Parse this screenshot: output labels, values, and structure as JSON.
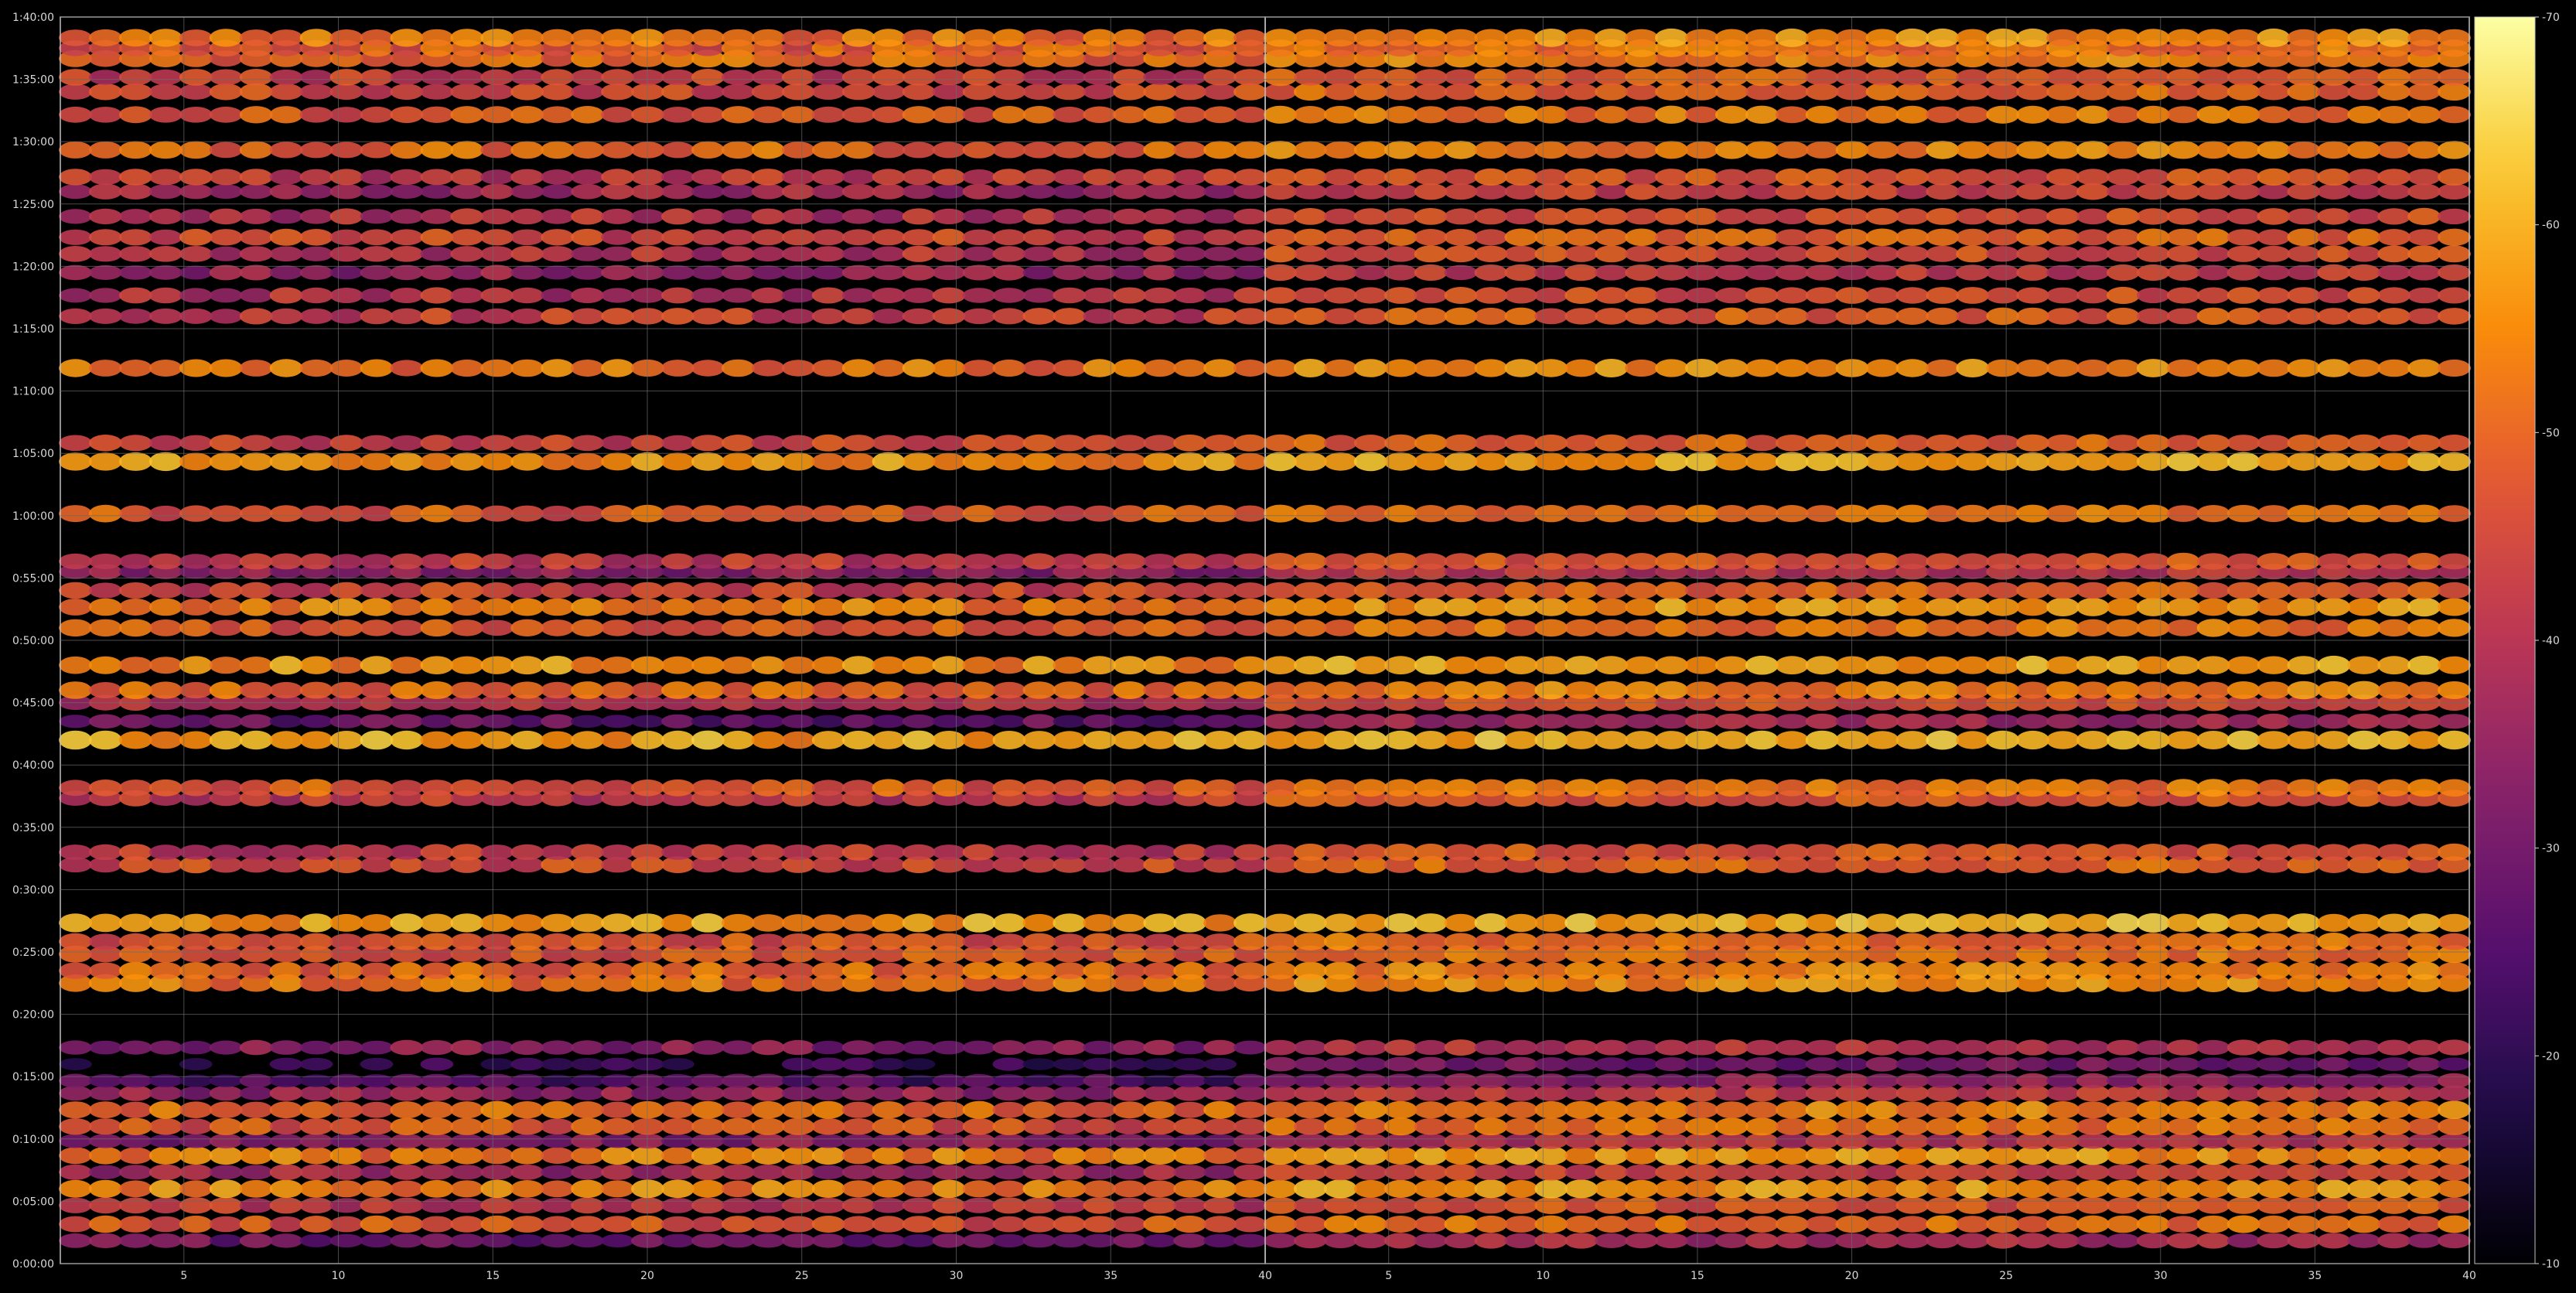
{
  "chart_data": {
    "type": "heatmap",
    "title": "",
    "xlabel": "",
    "ylabel": "",
    "grid": true,
    "background": "#000000",
    "colormap": "inferno",
    "colorbar": {
      "range": [
        -70,
        -10
      ],
      "ticks": [
        -10,
        -20,
        -30,
        -40,
        -50,
        -60,
        -70
      ],
      "tick_labels": [
        "-10",
        "-20",
        "-30",
        "-40",
        "-50",
        "-60",
        "-70"
      ]
    },
    "y_axis": {
      "unit": "h:mm:ss",
      "range_seconds": [
        0,
        6000
      ],
      "ticks": [
        "0:00:00",
        "0:05:00",
        "0:10:00",
        "0:15:00",
        "0:20:00",
        "0:25:00",
        "0:30:00",
        "0:35:00",
        "0:40:00",
        "0:45:00",
        "0:50:00",
        "0:55:00",
        "1:00:00",
        "1:05:00",
        "1:10:00",
        "1:15:00",
        "1:20:00",
        "1:25:00",
        "1:30:00",
        "1:35:00",
        "1:40:00"
      ]
    },
    "panels": [
      {
        "x_range": [
          1,
          40
        ],
        "x_ticks": [
          "5",
          "10",
          "15",
          "20",
          "25",
          "30",
          "35",
          "40"
        ],
        "level_scale": 1.0
      },
      {
        "x_range": [
          1,
          40
        ],
        "x_ticks": [
          "5",
          "10",
          "15",
          "20",
          "25",
          "30",
          "35",
          "40"
        ],
        "level_scale": 0.8
      }
    ],
    "bands": [
      {
        "t": 110,
        "level": -30
      },
      {
        "t": 190,
        "level": -47
      },
      {
        "t": 280,
        "level": -42
      },
      {
        "t": 360,
        "level": -54
      },
      {
        "t": 440,
        "level": -37
      },
      {
        "t": 520,
        "level": -53
      },
      {
        "t": 590,
        "level": -33
      },
      {
        "t": 660,
        "level": -47
      },
      {
        "t": 740,
        "level": -50
      },
      {
        "t": 820,
        "level": -35
      },
      {
        "t": 880,
        "level": -25
      },
      {
        "t": 960,
        "level": -20
      },
      {
        "t": 1040,
        "level": -33
      },
      {
        "t": 1350,
        "level": -52
      },
      {
        "t": 1410,
        "level": -50
      },
      {
        "t": 1490,
        "level": -48
      },
      {
        "t": 1550,
        "level": -47
      },
      {
        "t": 1640,
        "level": -58
      },
      {
        "t": 1920,
        "level": -45
      },
      {
        "t": 1980,
        "level": -42
      },
      {
        "t": 2240,
        "level": -42
      },
      {
        "t": 2290,
        "level": -48
      },
      {
        "t": 2520,
        "level": -58
      },
      {
        "t": 2610,
        "level": -28
      },
      {
        "t": 2700,
        "level": -40
      },
      {
        "t": 2760,
        "level": -50
      },
      {
        "t": 2880,
        "level": -56
      },
      {
        "t": 3060,
        "level": -48
      },
      {
        "t": 3160,
        "level": -54
      },
      {
        "t": 3240,
        "level": -44
      },
      {
        "t": 3330,
        "level": -33
      },
      {
        "t": 3380,
        "level": -42
      },
      {
        "t": 3610,
        "level": -48
      },
      {
        "t": 3860,
        "level": -56
      },
      {
        "t": 3950,
        "level": -44
      },
      {
        "t": 4310,
        "level": -52
      },
      {
        "t": 4560,
        "level": -43
      },
      {
        "t": 4660,
        "level": -40
      },
      {
        "t": 4770,
        "level": -35
      },
      {
        "t": 4860,
        "level": -40
      },
      {
        "t": 4940,
        "level": -44
      },
      {
        "t": 5040,
        "level": -40
      },
      {
        "t": 5160,
        "level": -37
      },
      {
        "t": 5230,
        "level": -42
      },
      {
        "t": 5360,
        "level": -50
      },
      {
        "t": 5530,
        "level": -48
      },
      {
        "t": 5640,
        "level": -45
      },
      {
        "t": 5710,
        "level": -43
      },
      {
        "t": 5800,
        "level": -50
      },
      {
        "t": 5850,
        "level": -48
      },
      {
        "t": 5900,
        "level": -52
      }
    ]
  }
}
